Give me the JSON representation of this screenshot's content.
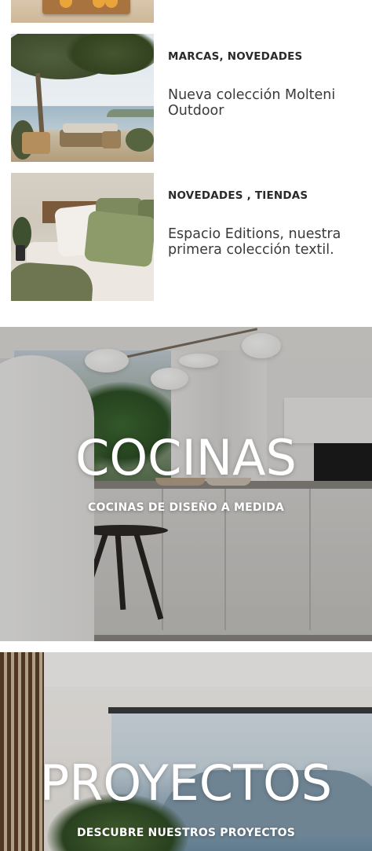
{
  "articles": [
    {
      "categories": "MARCAS, NOVEDADES",
      "title": "Nueva colección Molteni Outdoor",
      "image": "outdoor-terrace-photo"
    },
    {
      "categories": "NOVEDADES , TIENDAS",
      "title": "Espacio Editions, nuestra primera colección textil.",
      "image": "bedroom-textiles-photo"
    }
  ],
  "banners": {
    "kitchens": {
      "heading": "COCINAS",
      "subheading": "COCINAS DE DISEÑO A MEDIDA",
      "image": "kitchen-photo"
    },
    "projects": {
      "heading": "PROYECTOS",
      "subheading": "DESCUBRE NUESTROS PROYECTOS",
      "image": "living-room-seaview-photo"
    }
  },
  "colors": {
    "text_dark": "#2a2a2a",
    "text_body": "#3a3a3a",
    "overlay_text": "#ffffff",
    "background": "#ffffff"
  }
}
